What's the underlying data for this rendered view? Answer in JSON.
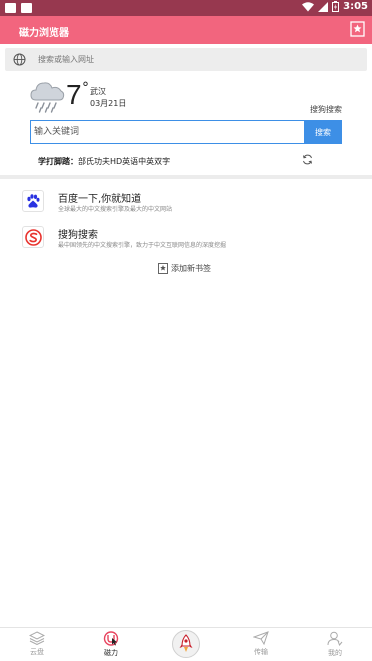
{
  "statusbar": {
    "time": "3:05"
  },
  "appbar": {
    "title": "磁力浏览器"
  },
  "urlbar": {
    "placeholder": "搜索或输入网址"
  },
  "weather": {
    "temperature": "7",
    "degree": "°",
    "city": "武汉",
    "date": "03月21日",
    "engine": "搜狗搜索"
  },
  "search": {
    "placeholder": "输入关键词",
    "button": "搜索"
  },
  "hotword": {
    "prefix": "学打脚踏：",
    "text": "部氏功夫HD英语中英双字"
  },
  "bookmarks": [
    {
      "title": "百度一下,你就知道",
      "desc": "全球最大的中文搜索引擎及最大的中文网站"
    },
    {
      "title": "搜狗搜索",
      "desc": "最中国领先的中文搜索引擎，致力于中文互联网信息的深度挖掘"
    }
  ],
  "add_bookmark": "添加新书签",
  "nav": {
    "items": [
      {
        "label": "云盘"
      },
      {
        "label": "磁力"
      },
      {
        "label": ""
      },
      {
        "label": "传输"
      },
      {
        "label": "我的"
      }
    ]
  },
  "colors": {
    "appbar": "#f2657e",
    "statusbar": "#97384f",
    "accent": "#3d8fe6"
  }
}
